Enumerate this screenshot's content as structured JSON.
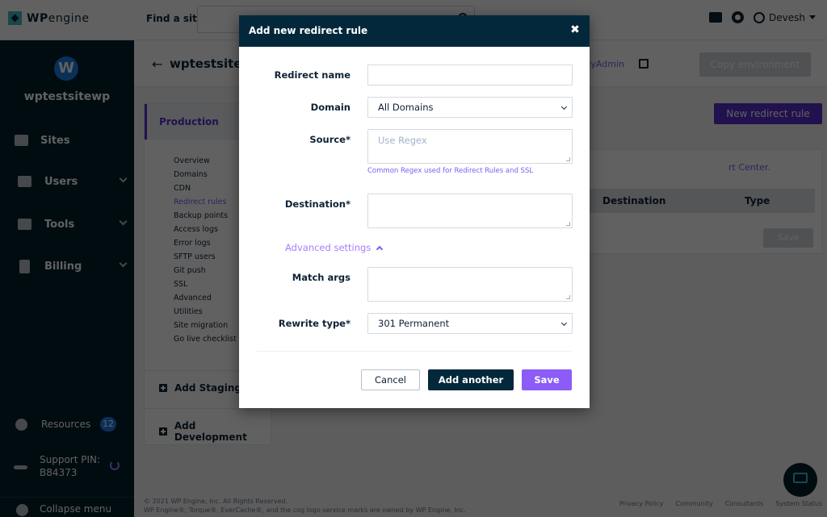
{
  "topbar": {
    "logo_bold": "WP",
    "logo_light": "engine",
    "find_label": "Find a site",
    "find_placeholder": "",
    "user_name": "Devesh"
  },
  "sidebar": {
    "site_initial": "W",
    "site_name": "wptestsitewp",
    "items": [
      {
        "label": "Sites",
        "icon": "sites-icon",
        "expandable": false
      },
      {
        "label": "Users",
        "icon": "users-icon",
        "expandable": true
      },
      {
        "label": "Tools",
        "icon": "tools-icon",
        "expandable": true
      },
      {
        "label": "Billing",
        "icon": "billing-icon",
        "expandable": true
      }
    ],
    "resources_label": "Resources",
    "resources_count": "12",
    "support_pin_label": "Support PIN:",
    "support_pin_value": "B84373",
    "collapse_label": "Collapse menu"
  },
  "page": {
    "back_label": "←",
    "title": "wptestsitew",
    "phpmyadmin_link": "phpMyAdmin",
    "copy_env_label": "Copy environment",
    "new_rule_label": "New redirect rule",
    "support_text": "rt Center.",
    "table_headers": [
      "Destination",
      "Type"
    ],
    "save_label": "Save"
  },
  "environment": {
    "title": "Production",
    "links": [
      {
        "label": "Overview",
        "active": false
      },
      {
        "label": "Domains",
        "active": false
      },
      {
        "label": "CDN",
        "active": false
      },
      {
        "label": "Redirect rules",
        "active": true
      },
      {
        "label": "Backup points",
        "active": false
      },
      {
        "label": "Access logs",
        "active": false
      },
      {
        "label": "Error logs",
        "active": false
      },
      {
        "label": "SFTP users",
        "active": false
      },
      {
        "label": "Git push",
        "active": false
      },
      {
        "label": "SSL",
        "active": false
      },
      {
        "label": "Advanced",
        "active": false
      },
      {
        "label": "Utilities",
        "active": false
      },
      {
        "label": "Site migration",
        "active": false
      },
      {
        "label": "Go live checklist",
        "active": false
      }
    ],
    "add_staging": "Add Staging",
    "add_development": "Add Development"
  },
  "footer": {
    "copyright": "© 2021 WP Engine, Inc. All Rights Reserved.",
    "trademark": "WP Engine®, Torque®, EverCache®, and the cog logo service marks are owned by WP Engine, Inc.",
    "links": [
      "Privacy Policy",
      "Community",
      "Consultants",
      "System Status"
    ]
  },
  "modal": {
    "title": "Add new redirect rule",
    "close_label": "✖",
    "fields": {
      "redirect_name": {
        "label": "Redirect name",
        "value": ""
      },
      "domain": {
        "label": "Domain",
        "value": "All Domains"
      },
      "source": {
        "label": "Source*",
        "value": "",
        "placeholder": "Use Regex"
      },
      "regex_help": "Common Regex used for Redirect Rules and SSL",
      "destination": {
        "label": "Destination*",
        "value": ""
      },
      "advanced_toggle": "Advanced settings",
      "match_args": {
        "label": "Match args",
        "value": ""
      },
      "rewrite_type": {
        "label": "Rewrite type*",
        "value": "301 Permanent"
      }
    },
    "buttons": {
      "cancel": "Cancel",
      "add_another": "Add another",
      "save": "Save"
    }
  },
  "colors": {
    "brand_dark": "#03283b",
    "accent_purple": "#5a2fd0",
    "save_purple": "#8b5cf6",
    "link_purple": "#7e5cef",
    "badge_blue": "#1b7ee6"
  }
}
